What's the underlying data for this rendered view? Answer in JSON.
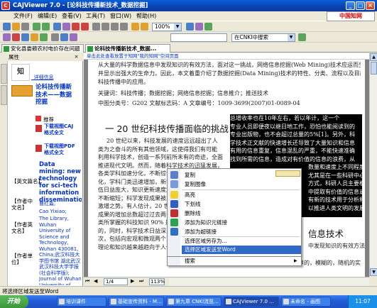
{
  "window": {
    "title": "CAJViewer 7.0 - [论科技传播新技术_数据挖掘]"
  },
  "menu": [
    "文件(F)",
    "编辑(E)",
    "查看(V)",
    "工具(T)",
    "窗口(W)",
    "帮助(H)"
  ],
  "cnki_logo": "中国知网",
  "toolbar": {
    "percent_value": "100%",
    "search_scope": "在CNKI中搜索"
  },
  "tabs": [
    {
      "label": "安化县娄赖农村电价存在问题"
    },
    {
      "label": "论科技传播新技术_数据..."
    }
  ],
  "left_panel": {
    "header": "属性",
    "details_link": "_详细信息",
    "title_link": "论科技传播新技术——数据挖掘",
    "recommend": "推荐",
    "download_caj": "下载视图CAJ格式全文",
    "download_pdf": "下载视图PDF格式全文",
    "english_title": "Data mining: new technology for sci-tech information dissemination",
    "fields": [
      {
        "label": "【英文篇名】"
      },
      {
        "label": "【作者中文名】",
        "value": "曹红淼;"
      },
      {
        "label": "【作者英文名】",
        "value": "Cao Yixiao;"
      },
      {
        "label": "【作者单位】",
        "value": "The Library, Wuhan University of Science and Technology, Wuhan 430081, China;武汉科技大学图书馆 湖北武汉 武汉科技大学学报(社会科学版); Journal of Wuhan University of Science and Technology"
      }
    ]
  },
  "ad_banner": "单击此处查看放置于知网\"我的知网\"空间页面",
  "document": {
    "lines": [
      "从大量的科学数据信息中发现知识的有效方法，面对这一挑战，网络信息挖掘(Web Mining)技术应运而生。",
      "并显示出强大的生命力。因此，本文着重介绍了数据挖掘(Data Mining)技术的特性、分类、流程以及目前在",
      "科技传播中的应用。",
      "关键词：科技传播；数据挖掘；网络信息挖掘；信息推介；推送技术",
      "中图分类号：G202     文献标志码：A     文章编号：1009-3699(2007)01-0089-04"
    ],
    "heading": "一 20 世纪科技传播面临的挑战",
    "paragraph": [
      "20 世纪以来，科技发展的速度远远超出了人",
      "类为之奋斗的所有其他领域，这使得我们有可能",
      "利用科学技术，创造一系列前所未有的奇迹，全面",
      "推进现代文明。然而，随着科学技术的迅猛发展，",
      "各类学科加速分化，不断综合，专业分工不断细",
      "化，学科门类迅速增加，新学科不断涌现；研究队",
      "伍日益庞大，知识更新速度加快，知识老化的周期",
      "不断缩短；科学发现成果被发明或专利\"量\"上呈",
      "激增之势。有人估计，20 世纪 70 年代以来，科技",
      "成果的增加总数超过过去两千年的总和，当代人",
      "类所掌握的科技知识 90% 是 20 世纪后半叶取得",
      "的，同时，科学技术日益深入到发现世界的更深层",
      "次，包括向宏观和微观两个方向发展，使科学技术",
      "理论和知识越来越趋向于人们的经验范围，科学技"
    ],
    "selected": [
      "总增收率也在10年左右，若以年计，这一个",
      "专业人员即便夜以继日地工作，恐怕也能阅读到的",
      "专业出版物，也不会超过总量的5%[1]。另外，科",
      "学技术正文献的快速增长还导致了大量知识和信息",
      "有用的信息重复，信息混乱的严重，不能快速准确",
      "找到所需的信息，造成对有价值的信息的浪费，从",
      "数量和速度上不同程度地阻碍了科技信息",
      "尤其是在一些科研中心，文献中心，",
      "方式，科研人员主要根据以科技信息数据",
      "中提取有价值的信息或知识，这也就",
      "有新的技术用于分析和提取，促进科",
      "以推进人类文明的发展。"
    ],
    "heading2": "信息技术",
    "para2": [
      "中发现知识的有效方法，面对这一挑战",
      "从大量的，不完全的，有噪声的，模糊的，随机的实"
    ]
  },
  "context_menu": {
    "items": [
      "复制",
      "复制图像",
      "高亮",
      "下划线",
      "删除线",
      "添加为知识元链接",
      "添加为超链接",
      "选择区域另存为...",
      "选择区域发送至Word",
      "搜索"
    ],
    "highlighted_index": 8
  },
  "hscroll": {
    "page_indicator": "1/4",
    "zoom": "113%"
  },
  "status_bar": "将选择区域发送至Word",
  "taskbar": {
    "start": "开始",
    "tasks": [
      "培训课件",
      "基础宣传资料 - M...",
      "第九章 CNKI流览...",
      "CAJViewer 7.0 ...",
      "未命名 - 画图"
    ],
    "clock": "11:07"
  }
}
